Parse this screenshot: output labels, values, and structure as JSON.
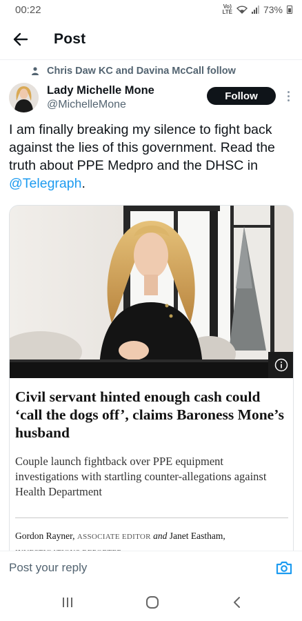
{
  "status_bar": {
    "time": "00:22",
    "volte_line1": "Vo)",
    "volte_line2": "LTE",
    "battery": "73%"
  },
  "header": {
    "back_icon": "arrow-left-icon",
    "title": "Post"
  },
  "social_context": {
    "icon": "person-icon",
    "text": "Chris Daw KC and Davina McCall follow"
  },
  "author": {
    "name": "Lady Michelle Mone",
    "handle": "@MichelleMone",
    "follow_label": "Follow"
  },
  "tweet": {
    "text_before": "I am finally breaking my silence to fight back against the lies of this government. Read the truth about PPE Medpro and the DHSC in ",
    "mention": "@Telegraph",
    "text_after": "."
  },
  "card": {
    "headline": "Civil servant hinted enough cash could ‘call the dogs off’, claims Baroness Mone’s husband",
    "standfirst": "Couple launch fightback over PPE equipment investigations with startling counter-allegations against Health Department",
    "byline": {
      "author1": "Gordon Rayner,",
      "role1": "ASSOCIATE EDITOR",
      "and": "and",
      "author2": "Janet Eastham",
      "comma": ",",
      "role2": "INVESTIGATIONS REPORTER"
    }
  },
  "reply": {
    "placeholder": "Post your reply",
    "camera_icon": "camera-icon"
  },
  "nav": {
    "recents_icon": "recents-icon",
    "home_icon": "home-icon",
    "back_icon": "back-chevron-icon"
  },
  "colors": {
    "accent": "#1d9bf0",
    "text_primary": "#0f1419",
    "text_secondary": "#536471",
    "follow_bg": "#0f1419"
  }
}
